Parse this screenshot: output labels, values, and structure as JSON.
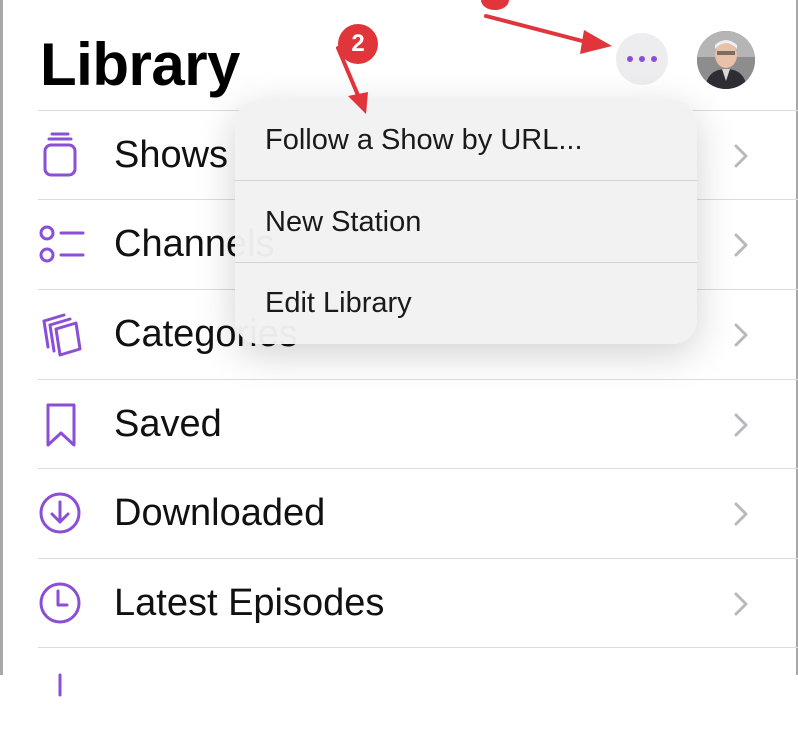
{
  "page": {
    "title": "Library"
  },
  "header": {
    "more_icon": "ellipsis-icon",
    "avatar_icon": "profile-photo"
  },
  "library_items": [
    {
      "label": "Shows",
      "icon": "shows-stack-icon"
    },
    {
      "label": "Channels",
      "icon": "channels-list-icon"
    },
    {
      "label": "Categories",
      "icon": "categories-icon"
    },
    {
      "label": "Saved",
      "icon": "bookmark-icon"
    },
    {
      "label": "Downloaded",
      "icon": "download-circle-icon"
    },
    {
      "label": "Latest Episodes",
      "icon": "clock-icon"
    }
  ],
  "menu": {
    "items": [
      {
        "label": "Follow a Show by URL..."
      },
      {
        "label": "New Station"
      },
      {
        "label": "Edit Library"
      }
    ]
  },
  "annotation": {
    "step_badge": "2"
  },
  "colors": {
    "accent": "#8a4fd6",
    "annotation_red": "#e0353b",
    "chevron": "#b8b8bd"
  }
}
